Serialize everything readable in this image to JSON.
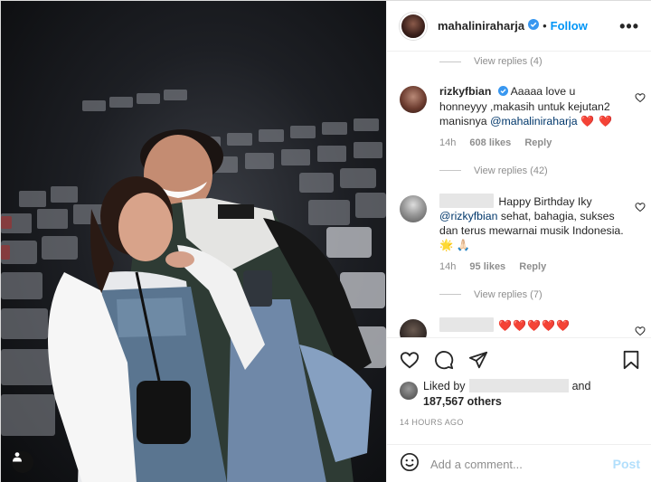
{
  "post": {
    "author": "mahaliniraharja",
    "follow_label": "Follow",
    "separator": "•",
    "more_label": "•••"
  },
  "comments": {
    "replies_top": "View replies (4)",
    "items": [
      {
        "user": "rizkyfbian",
        "verified": true,
        "text": "Aaaaa love u honneyyy ,makasih untuk kejutan2 manisnya",
        "mention": "@mahaliniraharja",
        "emoji": "❤️ ❤️",
        "time": "14h",
        "likes": "608 likes",
        "reply": "Reply",
        "replies": "View replies (42)"
      },
      {
        "user": "",
        "text": "Happy Birthday Iky",
        "mention": "@rizkyfbian",
        "text2": "sehat, bahagia, sukses dan terus mewarnai musik Indonesia.",
        "emoji": "🌟 🙏🏻",
        "time": "14h",
        "likes": "95 likes",
        "reply": "Reply",
        "replies": "View replies (7)"
      },
      {
        "user": "",
        "emoji": "❤️❤️❤️❤️❤️"
      }
    ]
  },
  "likes": {
    "prefix": "Liked by",
    "and": "and",
    "others": "187,567 others"
  },
  "timestamp": "14 HOURS AGO",
  "comment_box": {
    "placeholder": "Add a comment...",
    "post_label": "Post"
  },
  "colors": {
    "accent": "#0095f6",
    "heart": "#ed4956",
    "muted": "#8e8e8e"
  },
  "icons": [
    "heart-icon",
    "comment-icon",
    "share-icon",
    "save-icon",
    "emoji-icon",
    "verified-icon",
    "user-tag-icon",
    "more-icon"
  ]
}
